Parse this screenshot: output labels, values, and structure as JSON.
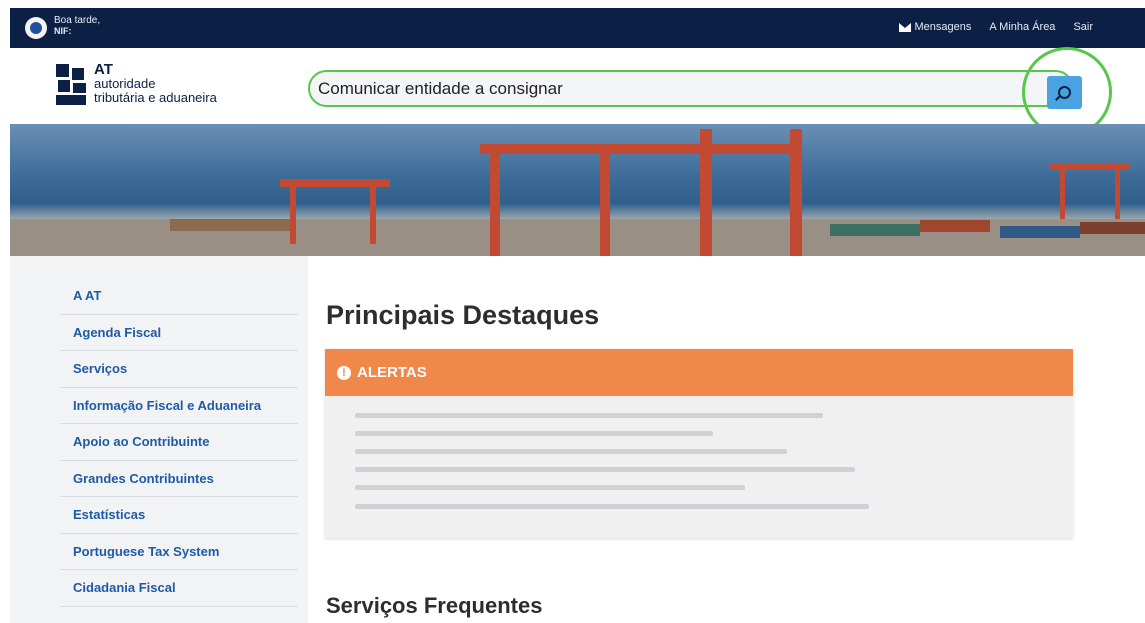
{
  "topbar": {
    "greeting": "Boa tarde,",
    "nif_label": "NIF:",
    "nav": {
      "messages": "Mensagens",
      "my_area": "A Minha Área",
      "logout": "Sair"
    }
  },
  "logo": {
    "line1": "AT",
    "line2": "autoridade",
    "line3": "tributária e aduaneira"
  },
  "search": {
    "value": "Comunicar entidade a consignar",
    "button_icon": "search-icon",
    "highlight_color": "#56c74a"
  },
  "sidebar": {
    "items": [
      {
        "label": "A AT"
      },
      {
        "label": "Agenda Fiscal"
      },
      {
        "label": "Serviços"
      },
      {
        "label": "Informação Fiscal e Aduaneira"
      },
      {
        "label": "Apoio ao Contribuinte"
      },
      {
        "label": "Grandes Contribuintes"
      },
      {
        "label": "Estatísticas"
      },
      {
        "label": "Portuguese Tax System"
      },
      {
        "label": "Cidadania Fiscal"
      }
    ]
  },
  "main": {
    "title": "Principais Destaques",
    "alert": {
      "label": "ALERTAS",
      "icon": "exclamation-circle-icon",
      "color": "#ef884a"
    },
    "section2_title": "Serviços Frequentes"
  },
  "colors": {
    "topbar": "#0b2044",
    "link": "#1f5aa6",
    "search_button": "#4aa3e0"
  }
}
